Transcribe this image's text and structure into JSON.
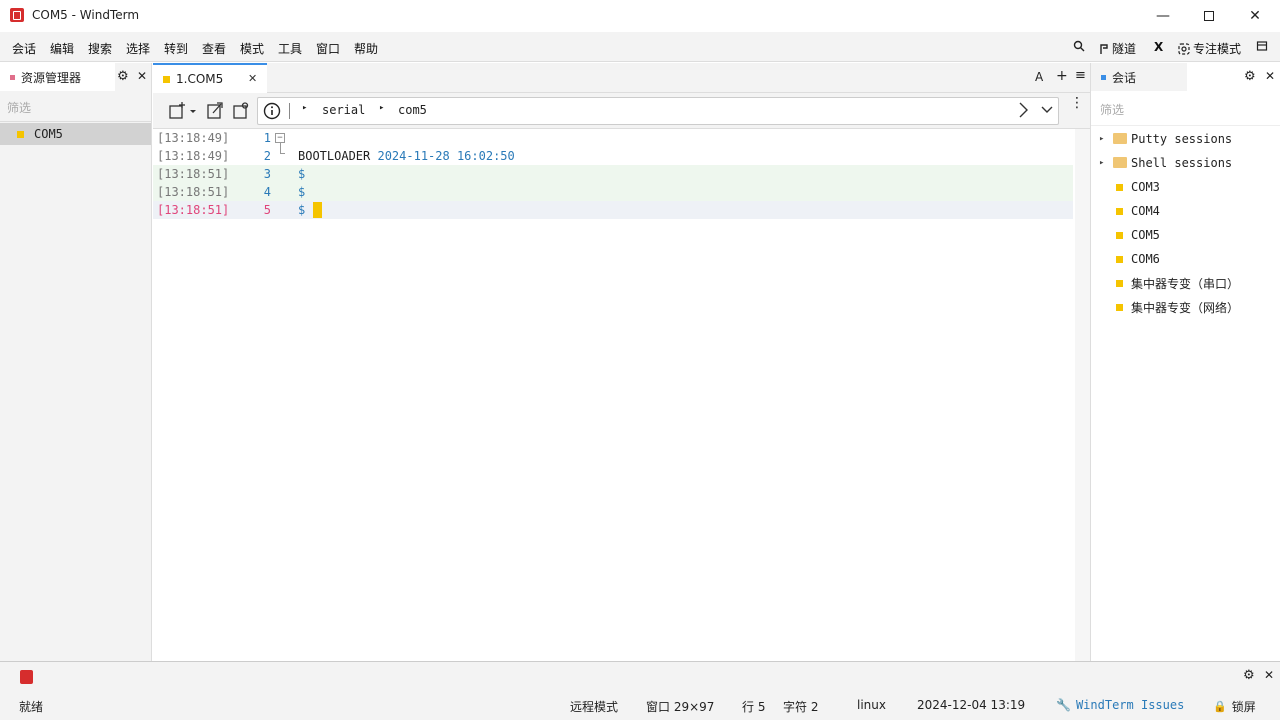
{
  "window": {
    "title": "COM5 - WindTerm"
  },
  "menu": [
    "会话",
    "编辑",
    "搜索",
    "选择",
    "转到",
    "查看",
    "模式",
    "工具",
    "窗口",
    "帮助"
  ],
  "menu_right": {
    "tunnel": "隧道",
    "x": "X",
    "focus_mode": "专注模式"
  },
  "left_panel": {
    "tab_label": "资源管理器",
    "filter_placeholder": "筛选",
    "items": [
      "COM5"
    ]
  },
  "terminal": {
    "tab_label": "1.COM5",
    "breadcrumb": [
      "serial",
      "com5"
    ],
    "lines": [
      {
        "time": "[13:18:49]",
        "num": "1",
        "text": "",
        "date": ""
      },
      {
        "time": "[13:18:49]",
        "num": "2",
        "text": "BOOTLOADER",
        "date": "2024-11-28 16:02:50"
      },
      {
        "time": "[13:18:51]",
        "num": "3",
        "text": "$",
        "date": ""
      },
      {
        "time": "[13:18:51]",
        "num": "4",
        "text": "$",
        "date": ""
      },
      {
        "time": "[13:18:51]",
        "num": "5",
        "text": "$",
        "date": ""
      }
    ]
  },
  "right_panel": {
    "tab_label": "会话",
    "filter_placeholder": "筛选",
    "folders": [
      "Putty sessions",
      "Shell sessions"
    ],
    "sessions": [
      "COM3",
      "COM4",
      "COM5",
      "COM6",
      "集中器专变（串口）",
      "集中器专变（网络）"
    ]
  },
  "status": {
    "ready": "就绪",
    "remote_mode": "远程模式",
    "window_size": "窗口 29×97",
    "row": "行 5",
    "col": "字符 2",
    "os": "linux",
    "datetime": "2024-12-04 13:19",
    "issues": "WindTerm Issues",
    "lock": "锁屏"
  },
  "colors": {
    "accent": "#3a8ee6",
    "session_square": "#f5c400",
    "highlight_line": "#eef7ee",
    "cursor_line": "#eef1f6",
    "timestamp_active": "#e0457b"
  }
}
